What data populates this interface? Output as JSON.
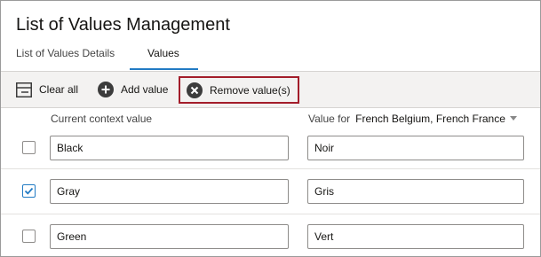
{
  "page": {
    "title": "List of Values Management"
  },
  "tabs": [
    {
      "label": "List of Values Details",
      "selected": false
    },
    {
      "label": "Values",
      "selected": true
    }
  ],
  "toolbar": {
    "clear_all": {
      "label": "Clear all",
      "icon": "clear-all-icon"
    },
    "add_value": {
      "label": "Add value",
      "icon": "plus-circle-icon"
    },
    "remove_values": {
      "label": "Remove value(s)",
      "icon": "x-circle-icon",
      "highlight_color": "#a31d2a"
    }
  },
  "table": {
    "col1_header": "Current context value",
    "col2_header": "Value for",
    "language_selected": "French Belgium, French France",
    "rows": [
      {
        "checked": false,
        "current": "Black",
        "translated": "Noir"
      },
      {
        "checked": true,
        "current": "Gray",
        "translated": "Gris"
      },
      {
        "checked": false,
        "current": "Green",
        "translated": "Vert"
      }
    ]
  },
  "colors": {
    "accent": "#227bc4",
    "toolbar_bg": "#f3f2f1"
  }
}
